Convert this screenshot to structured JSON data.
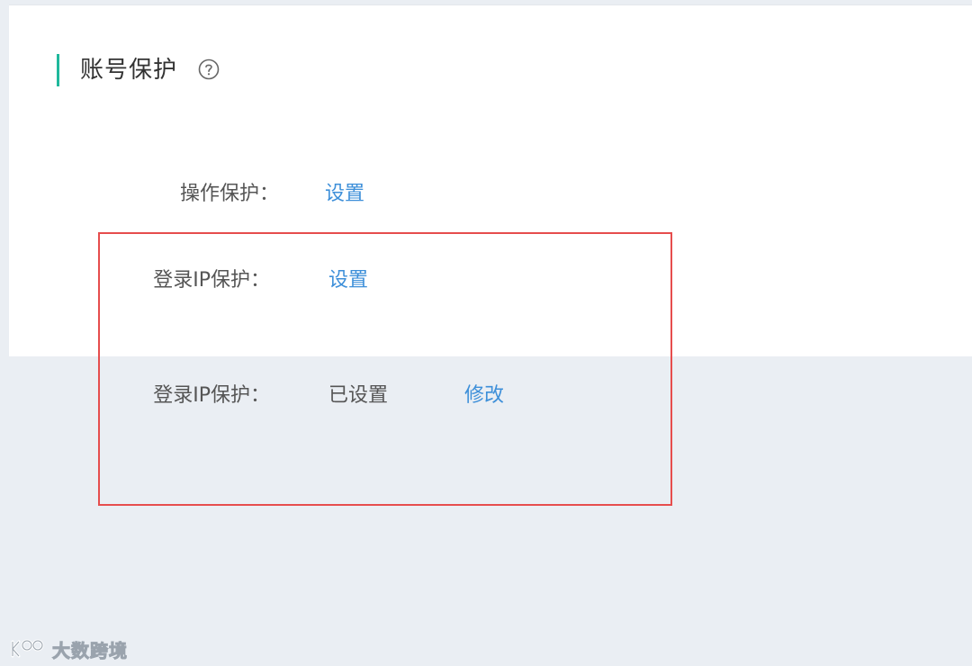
{
  "section": {
    "title": "账号保护",
    "help_icon": "question-circle-icon"
  },
  "rows": [
    {
      "label": "操作保护：",
      "link": "设置"
    },
    {
      "label": "登录IP保护：",
      "link": "设置"
    },
    {
      "label": "登录IP保护：",
      "status": "已设置",
      "link": "修改"
    }
  ],
  "watermark": {
    "text": "大数跨境",
    "icon": "brand-logo-icon"
  },
  "colors": {
    "accent_bar": "#1fb89c",
    "link": "#3d8fd9",
    "highlight_box": "#e64d4d",
    "card_bg": "#ffffff",
    "page_bg": "#eaeef3"
  }
}
